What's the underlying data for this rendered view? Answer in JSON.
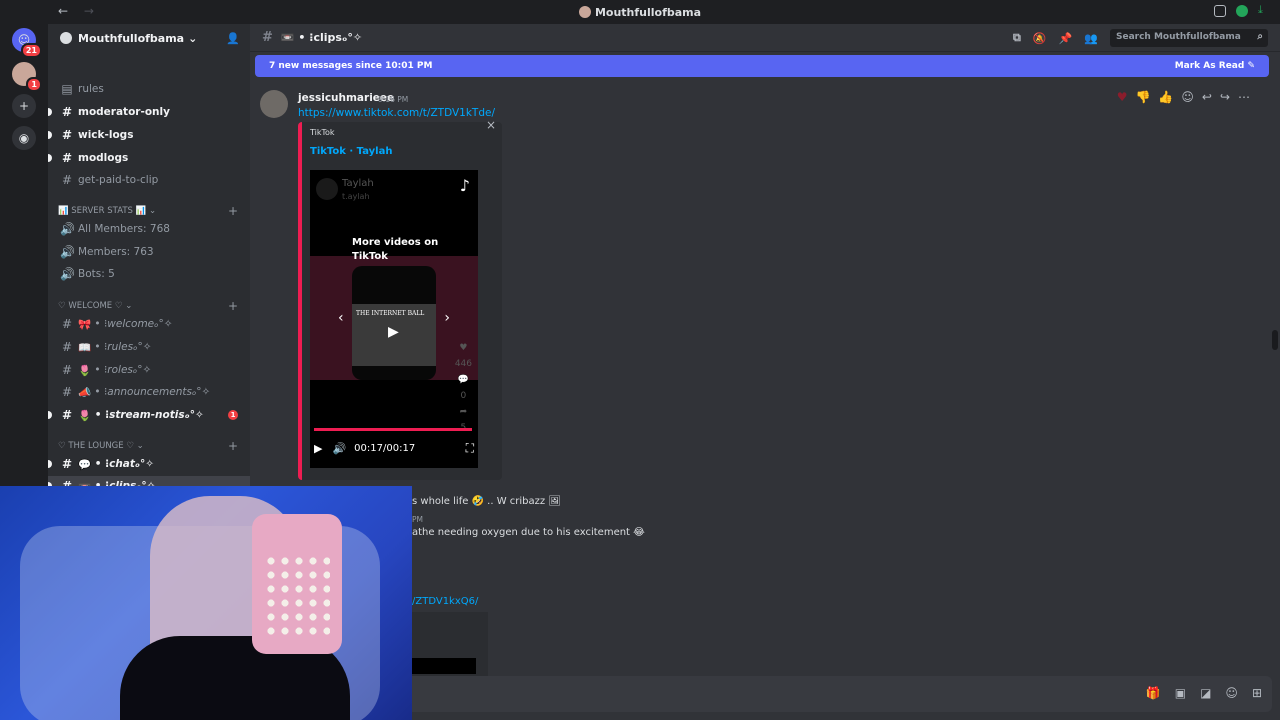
{
  "titlebar": {
    "back": "←",
    "forward": "→",
    "title": "Mouthfullofbama"
  },
  "servers": {
    "home_badge": "21",
    "server1_badge": "1"
  },
  "sidebar": {
    "server_name": "Mouthfullofbama",
    "channels_top": [
      {
        "label": "rules",
        "unread": false
      },
      {
        "label": "moderator-only",
        "unread": true
      },
      {
        "label": "wick-logs",
        "unread": true
      },
      {
        "label": "modlogs",
        "unread": true
      },
      {
        "label": "get-paid-to-clip",
        "unread": false
      }
    ],
    "cat_stats": "📊 SERVER STATS 📊",
    "stats": [
      {
        "label": "All Members: 768"
      },
      {
        "label": "Members: 763"
      },
      {
        "label": "Bots: 5"
      }
    ],
    "cat_welcome": "♡ WELCOME ♡",
    "welcome": [
      {
        "emoji": "🎀",
        "label": "welcomeₒ°✧",
        "unread": false
      },
      {
        "emoji": "📖",
        "label": "rulesₒ°✧",
        "unread": false
      },
      {
        "emoji": "🌷",
        "label": "rolesₒ°✧",
        "unread": false
      },
      {
        "emoji": "📣",
        "label": "announcementsₒ°✧",
        "unread": false
      },
      {
        "emoji": "🌷",
        "label": "stream-notisₒ°✧",
        "unread": true,
        "mentions": "1"
      }
    ],
    "cat_lounge": "♡ THE LOUNGE ♡",
    "lounge": [
      {
        "emoji": "💬",
        "label": "chatₒ°✧",
        "unread": true
      },
      {
        "emoji": "📼",
        "label": "clipsₒ°✧",
        "unread": true
      }
    ]
  },
  "header": {
    "channel": "📼 • ⁝clipsₒ°✧",
    "search_placeholder": "Search Mouthfullofbama"
  },
  "newbar": {
    "text": "7 new messages since 10:01 PM",
    "mark": "Mark As Read"
  },
  "message": {
    "author": "jessicuhmarieee",
    "time": "9:16 PM",
    "link": "https://www.tiktok.com/t/ZTDV1kTde/"
  },
  "embed": {
    "provider": "TikTok",
    "title": "TikTok · Taylah",
    "video": {
      "user": "Taylah",
      "handle": "t.aylah",
      "more_videos": "More videos on TikTok",
      "thumb_text": "THE INTERNET BALL",
      "likes": "446",
      "comments": "0",
      "shares": "5",
      "time": "00:17/00:17"
    }
  },
  "later": {
    "line1": "s whole life 🤣 .. W cribazz 🖼",
    "time2": "PM",
    "line2": "athe needing oxygen due to his excitement 😂",
    "link2": "/ZTDV1kxQ6/"
  }
}
